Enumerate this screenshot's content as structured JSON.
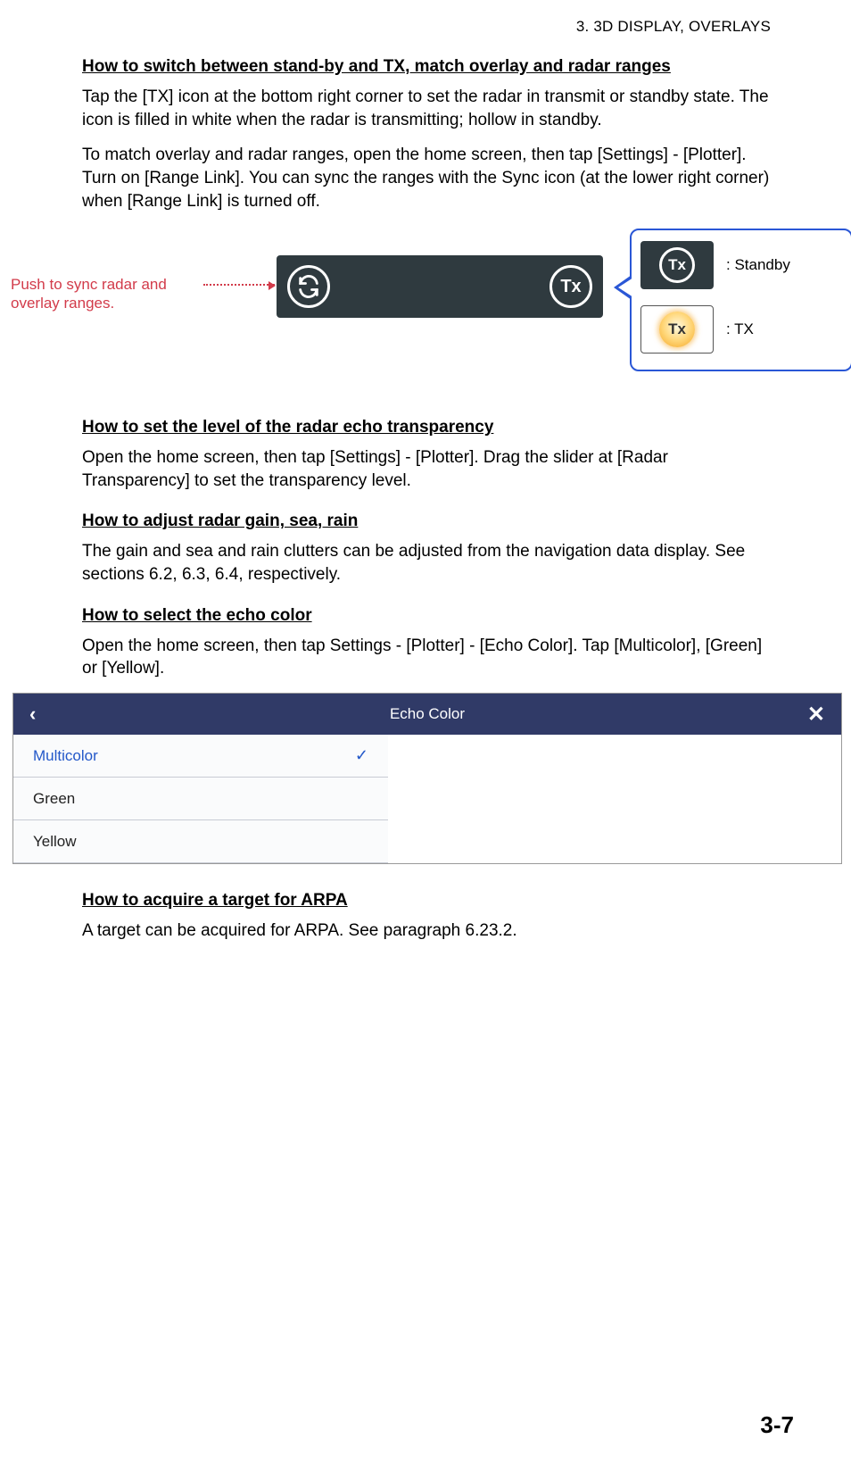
{
  "header": {
    "chapter_label": "3.  3D DISPLAY, OVERLAYS"
  },
  "sections": {
    "s1": {
      "title": "How to switch between stand-by and TX, match overlay and radar ranges",
      "p1": "Tap the [TX] icon at the bottom right corner to set the radar in transmit or standby state. The icon is filled in white when the radar is transmitting; hollow in standby.",
      "p2": "To match overlay and radar ranges, open the home screen, then tap [Settings] - [Plotter]. Turn on [Range Link]. You can sync the ranges with the Sync icon (at the lower right corner) when [Range Link] is turned off."
    },
    "figure1": {
      "sync_label": "Push to sync radar and overlay ranges.",
      "tx_icon_text": "Tx",
      "callout_standby": ": Standby",
      "callout_tx": ": TX"
    },
    "s2": {
      "title": "How to set the level of the radar echo transparency",
      "p1": "Open the home screen, then tap [Settings] - [Plotter]. Drag the slider at [Radar Transparency] to set the transparency level."
    },
    "s3": {
      "title": "How to adjust radar gain, sea, rain",
      "p1": "The gain and sea and rain clutters can be adjusted from the navigation data display. See sections 6.2, 6.3, 6.4, respectively."
    },
    "s4": {
      "title": "How to select the echo color",
      "p1": "Open the home screen, then tap Settings - [Plotter] - [Echo Color]. Tap [Multicolor], [Green] or [Yellow]."
    },
    "echo_menu": {
      "title": "Echo Color",
      "items": [
        "Multicolor",
        "Green",
        "Yellow"
      ],
      "selected_index": 0
    },
    "s5": {
      "title": "How to acquire a target for ARPA",
      "p1": "A target can be acquired for ARPA. See paragraph 6.23.2."
    }
  },
  "page_number": "3-7"
}
